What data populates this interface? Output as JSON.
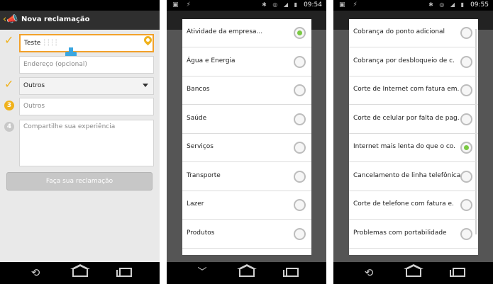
{
  "phone1": {
    "status": {
      "left_icons": "",
      "time": ""
    },
    "appbar_title": "Nova reclamação",
    "name_value": "Teste",
    "address_placeholder": "Endereço (opcional)",
    "category_selected": "Outros",
    "other_placeholder": "Outros",
    "experience_placeholder": "Compartilhe sua experiência",
    "step3": "3",
    "step4": "4",
    "submit_label": "Faça sua reclamação",
    "colors": {
      "accent": "#f0b21c",
      "active_border": "#f2a12a",
      "appbar": "#2f2f2f"
    }
  },
  "phone2": {
    "time": "09:54",
    "options": [
      {
        "label": "Atividade da empresa...",
        "selected": true
      },
      {
        "label": "Água e Energia",
        "selected": false
      },
      {
        "label": "Bancos",
        "selected": false
      },
      {
        "label": "Saúde",
        "selected": false
      },
      {
        "label": "Serviços",
        "selected": false
      },
      {
        "label": "Transporte",
        "selected": false
      },
      {
        "label": "Lazer",
        "selected": false
      },
      {
        "label": "Produtos",
        "selected": false
      }
    ]
  },
  "phone3": {
    "time": "09:55",
    "options": [
      {
        "label": "Cobrança do ponto adicional",
        "selected": false
      },
      {
        "label": "Cobrança por desbloqueio de c.",
        "selected": false
      },
      {
        "label": "Corte de Internet com fatura em.",
        "selected": false
      },
      {
        "label": "Corte de celular por falta de pag.",
        "selected": false
      },
      {
        "label": "Internet mais lenta do que o co.",
        "selected": true
      },
      {
        "label": "Cancelamento de linha telefônica",
        "selected": false
      },
      {
        "label": "Corte de telefone com fatura e.",
        "selected": false
      },
      {
        "label": "Problemas com portabilidade",
        "selected": false
      }
    ]
  }
}
